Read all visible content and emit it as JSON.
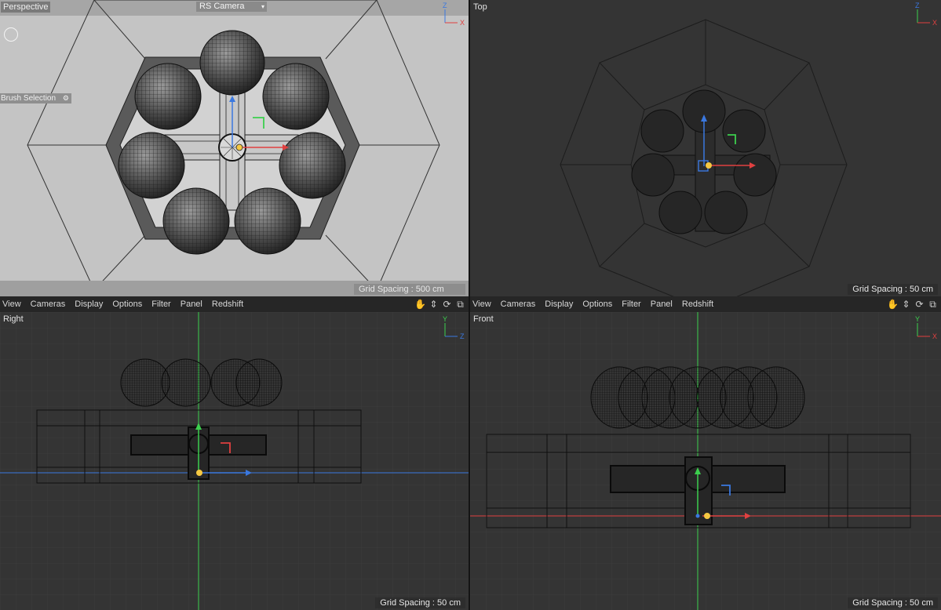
{
  "viewports": {
    "perspective": {
      "title": "Perspective",
      "camera": "RS Camera",
      "brush_selection": "Brush Selection",
      "grid_spacing": "Grid Spacing : 500 cm"
    },
    "top": {
      "title": "Top",
      "grid_spacing": "Grid Spacing : 50 cm"
    },
    "right": {
      "title": "Right",
      "grid_spacing": "Grid Spacing : 50 cm"
    },
    "front": {
      "title": "Front",
      "grid_spacing": "Grid Spacing : 50 cm"
    }
  },
  "menu": {
    "items": [
      "View",
      "Cameras",
      "Display",
      "Options",
      "Filter",
      "Panel",
      "Redshift"
    ],
    "icons": [
      "hand-icon",
      "move-icon",
      "rotate-icon",
      "maximize-icon"
    ]
  },
  "axes": {
    "perspective": [
      "Z",
      "X"
    ],
    "top": [
      "Z",
      "X"
    ],
    "right": [
      "Y",
      "Z"
    ],
    "front": [
      "Y",
      "X"
    ]
  },
  "colors": {
    "x_axis": "#e04040",
    "y_axis": "#3ccf4e",
    "z_axis": "#3a78e0",
    "pivot": "#f5c842"
  }
}
